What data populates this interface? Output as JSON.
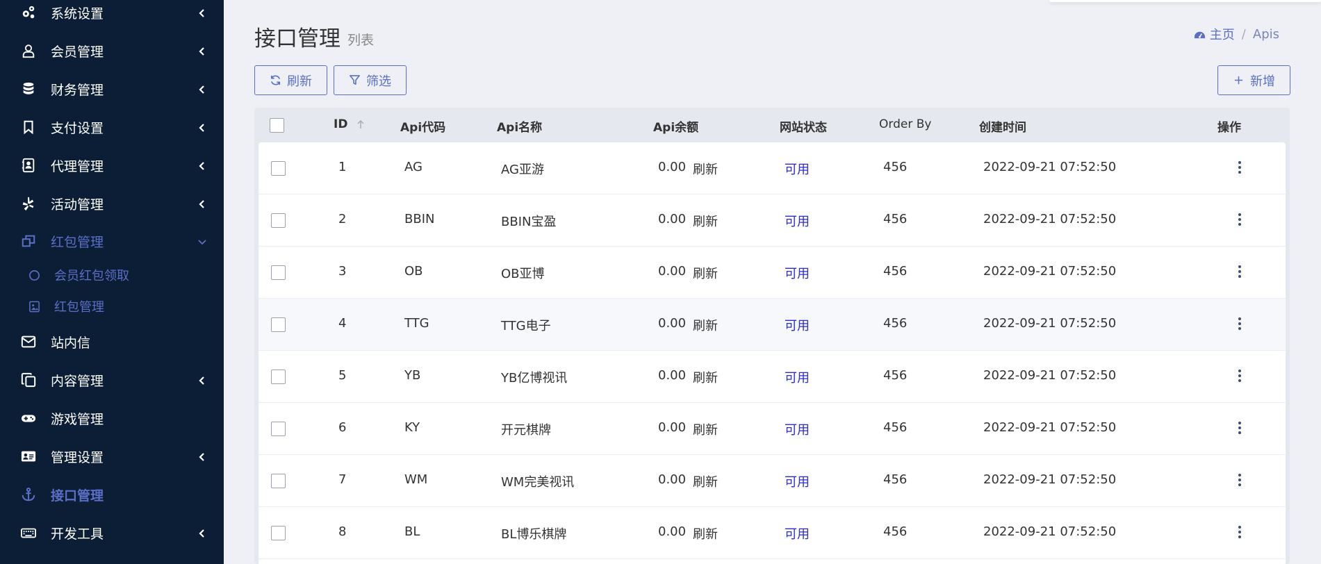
{
  "sidebar": {
    "items": [
      {
        "label": "系统设置",
        "icon": "gears-icon",
        "arrow": "chevron-left-icon"
      },
      {
        "label": "会员管理",
        "icon": "user-icon",
        "arrow": "chevron-left-icon"
      },
      {
        "label": "财务管理",
        "icon": "database-icon",
        "arrow": "chevron-left-icon"
      },
      {
        "label": "支付设置",
        "icon": "bookmark-icon",
        "arrow": "chevron-left-icon"
      },
      {
        "label": "代理管理",
        "icon": "contact-book-icon",
        "arrow": "chevron-left-icon"
      },
      {
        "label": "活动管理",
        "icon": "yelp-icon",
        "arrow": "chevron-left-icon"
      },
      {
        "label": "红包管理",
        "icon": "windows-restore-icon",
        "arrow": "chevron-down-icon"
      },
      {
        "label": "站内信",
        "icon": "envelope-icon"
      },
      {
        "label": "内容管理",
        "icon": "copy-icon",
        "arrow": "chevron-left-icon"
      },
      {
        "label": "游戏管理",
        "icon": "gamepad-icon"
      },
      {
        "label": "管理设置",
        "icon": "id-card-icon",
        "arrow": "chevron-left-icon"
      },
      {
        "label": "接口管理",
        "icon": "anchor-icon"
      },
      {
        "label": "开发工具",
        "icon": "keyboard-icon",
        "arrow": "chevron-left-icon"
      }
    ],
    "subitems": [
      {
        "label": "会员红包领取",
        "icon": "circle-icon"
      },
      {
        "label": "红包管理",
        "icon": "image-icon"
      }
    ],
    "active_color": "#5b6fc6",
    "background": "#0c1d36"
  },
  "header": {
    "title": "接口管理",
    "subtitle": "列表",
    "breadcrumb": {
      "home": "主页",
      "separator": "/",
      "current": "Apis"
    }
  },
  "toolbar": {
    "refresh_label": "刷新",
    "filter_label": "筛选",
    "add_label": "新增"
  },
  "table": {
    "columns": {
      "id": "ID",
      "code": "Api代码",
      "name": "Api名称",
      "balance": "Api余额",
      "status": "网站状态",
      "order_by": "Order By",
      "created": "创建时间",
      "actions": "操作"
    },
    "rows": [
      {
        "id": "1",
        "code": "AG",
        "name": "AG亚游",
        "balance": "0.00",
        "refresh": "刷新",
        "status": "可用",
        "order_by": "456",
        "created": "2022-09-21 07:52:50"
      },
      {
        "id": "2",
        "code": "BBIN",
        "name": "BBIN宝盈",
        "balance": "0.00",
        "refresh": "刷新",
        "status": "可用",
        "order_by": "456",
        "created": "2022-09-21 07:52:50"
      },
      {
        "id": "3",
        "code": "OB",
        "name": "OB亚博",
        "balance": "0.00",
        "refresh": "刷新",
        "status": "可用",
        "order_by": "456",
        "created": "2022-09-21 07:52:50"
      },
      {
        "id": "4",
        "code": "TTG",
        "name": "TTG电子",
        "balance": "0.00",
        "refresh": "刷新",
        "status": "可用",
        "order_by": "456",
        "created": "2022-09-21 07:52:50"
      },
      {
        "id": "5",
        "code": "YB",
        "name": "YB亿博视讯",
        "balance": "0.00",
        "refresh": "刷新",
        "status": "可用",
        "order_by": "456",
        "created": "2022-09-21 07:52:50"
      },
      {
        "id": "6",
        "code": "KY",
        "name": "开元棋牌",
        "balance": "0.00",
        "refresh": "刷新",
        "status": "可用",
        "order_by": "456",
        "created": "2022-09-21 07:52:50"
      },
      {
        "id": "7",
        "code": "WM",
        "name": "WM完美视讯",
        "balance": "0.00",
        "refresh": "刷新",
        "status": "可用",
        "order_by": "456",
        "created": "2022-09-21 07:52:50"
      },
      {
        "id": "8",
        "code": "BL",
        "name": "BL博乐棋牌",
        "balance": "0.00",
        "refresh": "刷新",
        "status": "可用",
        "order_by": "456",
        "created": "2022-09-21 07:52:50"
      }
    ],
    "status_color": "#2a2ad8"
  }
}
